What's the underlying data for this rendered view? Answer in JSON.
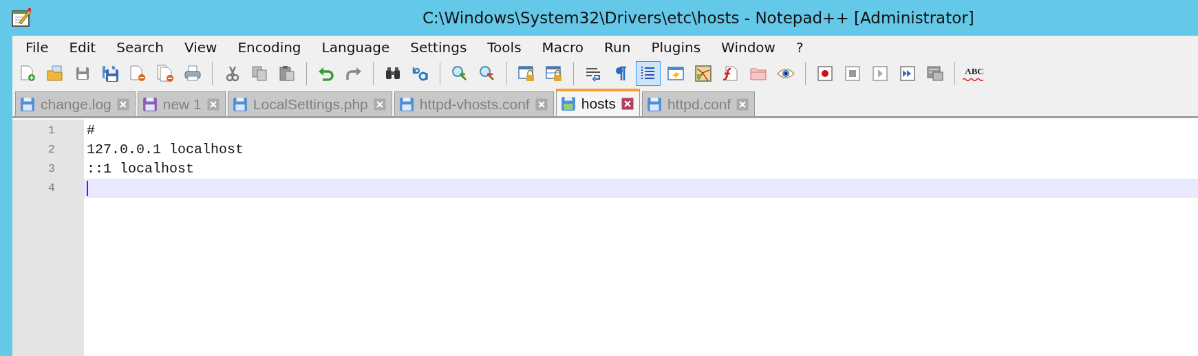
{
  "window": {
    "title": "C:\\Windows\\System32\\Drivers\\etc\\hosts - Notepad++ [Administrator]"
  },
  "menu": [
    "File",
    "Edit",
    "Search",
    "View",
    "Encoding",
    "Language",
    "Settings",
    "Tools",
    "Macro",
    "Run",
    "Plugins",
    "Window",
    "?"
  ],
  "toolbar": [
    {
      "kind": "new",
      "pressed": false
    },
    {
      "kind": "open",
      "pressed": false
    },
    {
      "kind": "save",
      "pressed": false
    },
    {
      "kind": "saveall",
      "pressed": false
    },
    {
      "kind": "close",
      "pressed": false
    },
    {
      "kind": "closeall",
      "pressed": false
    },
    {
      "kind": "print",
      "pressed": false
    },
    {
      "kind": "separator"
    },
    {
      "kind": "cut",
      "pressed": false
    },
    {
      "kind": "copy",
      "pressed": false
    },
    {
      "kind": "paste",
      "pressed": false
    },
    {
      "kind": "separator"
    },
    {
      "kind": "undo",
      "pressed": false
    },
    {
      "kind": "redo",
      "pressed": false
    },
    {
      "kind": "separator"
    },
    {
      "kind": "find",
      "pressed": false
    },
    {
      "kind": "replace",
      "pressed": false
    },
    {
      "kind": "separator"
    },
    {
      "kind": "zoomin",
      "pressed": false
    },
    {
      "kind": "zoomout",
      "pressed": false
    },
    {
      "kind": "separator"
    },
    {
      "kind": "syncv",
      "pressed": false
    },
    {
      "kind": "synch",
      "pressed": false
    },
    {
      "kind": "separator"
    },
    {
      "kind": "wrap",
      "pressed": false
    },
    {
      "kind": "pilcrow",
      "pressed": false
    },
    {
      "kind": "indent",
      "pressed": true
    },
    {
      "kind": "userlang",
      "pressed": false
    },
    {
      "kind": "map",
      "pressed": false
    },
    {
      "kind": "function",
      "pressed": false
    },
    {
      "kind": "folder",
      "pressed": false
    },
    {
      "kind": "eye",
      "pressed": false
    },
    {
      "kind": "separator"
    },
    {
      "kind": "record",
      "pressed": false
    },
    {
      "kind": "stop",
      "pressed": false
    },
    {
      "kind": "play",
      "pressed": false
    },
    {
      "kind": "playmulti",
      "pressed": false
    },
    {
      "kind": "savemacro",
      "pressed": false
    },
    {
      "kind": "separator"
    },
    {
      "kind": "spell",
      "label": "ABC",
      "pressed": false
    }
  ],
  "tabs": [
    {
      "label": "change.log",
      "selected": false,
      "color": "#4f8fd8"
    },
    {
      "label": "new 1",
      "selected": false,
      "color": "#8a5fb0"
    },
    {
      "label": "LocalSettings.php",
      "selected": false,
      "color": "#4f8fd8"
    },
    {
      "label": "httpd-vhosts.conf",
      "selected": false,
      "color": "#4f8fd8"
    },
    {
      "label": "hosts",
      "selected": true,
      "color": "#4f8fd8"
    },
    {
      "label": "httpd.conf",
      "selected": false,
      "color": "#4f8fd8"
    }
  ],
  "editor": {
    "lines": [
      {
        "number": "1",
        "text": "#",
        "current": false
      },
      {
        "number": "2",
        "text": "127.0.0.1 localhost",
        "current": false
      },
      {
        "number": "3",
        "text": "::1 localhost",
        "current": false
      },
      {
        "number": "4",
        "current": true
      }
    ]
  }
}
